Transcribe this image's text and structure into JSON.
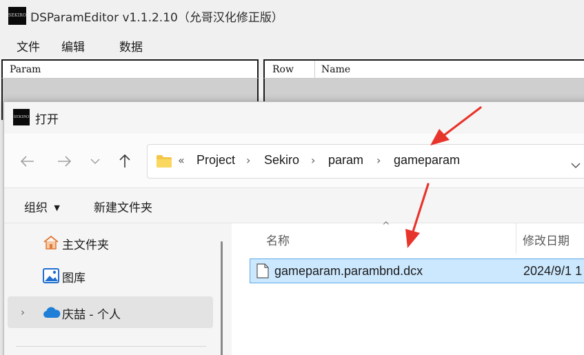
{
  "app": {
    "title": "DSParamEditor v1.1.2.10（允哥汉化修正版）",
    "icon_text": "SEKIRO"
  },
  "menu": [
    "文件",
    "编辑",
    "数据"
  ],
  "param_panel": {
    "column": "Param"
  },
  "row_panel": {
    "columns": [
      "Row",
      "Name"
    ]
  },
  "dialog": {
    "title": "打开",
    "icon_text": "SEKIRO",
    "breadcrumb": [
      "Project",
      "Sekiro",
      "param",
      "gameparam"
    ],
    "breadcrumb_overflow": "«",
    "commands": {
      "organize": "组织",
      "new_folder": "新建文件夹"
    },
    "nav_items": [
      {
        "label": "主文件夹",
        "icon": "home-icon"
      },
      {
        "label": "图库",
        "icon": "gallery-icon"
      },
      {
        "label": "庆喆 - 个人",
        "icon": "onedrive-cloud-icon",
        "selected": true
      }
    ],
    "columns": {
      "name": "名称",
      "modified": "修改日期"
    },
    "files": [
      {
        "name": "gameparam.parambnd.dcx",
        "modified": "2024/9/1 1",
        "selected": true
      }
    ]
  },
  "colors": {
    "selection_fill": "#cce8ff",
    "selection_border": "#5aa9e6",
    "annotation_arrow": "#e8352b",
    "folder_yellow": "#f4c64a",
    "onedrive_blue": "#1f7fd6"
  }
}
